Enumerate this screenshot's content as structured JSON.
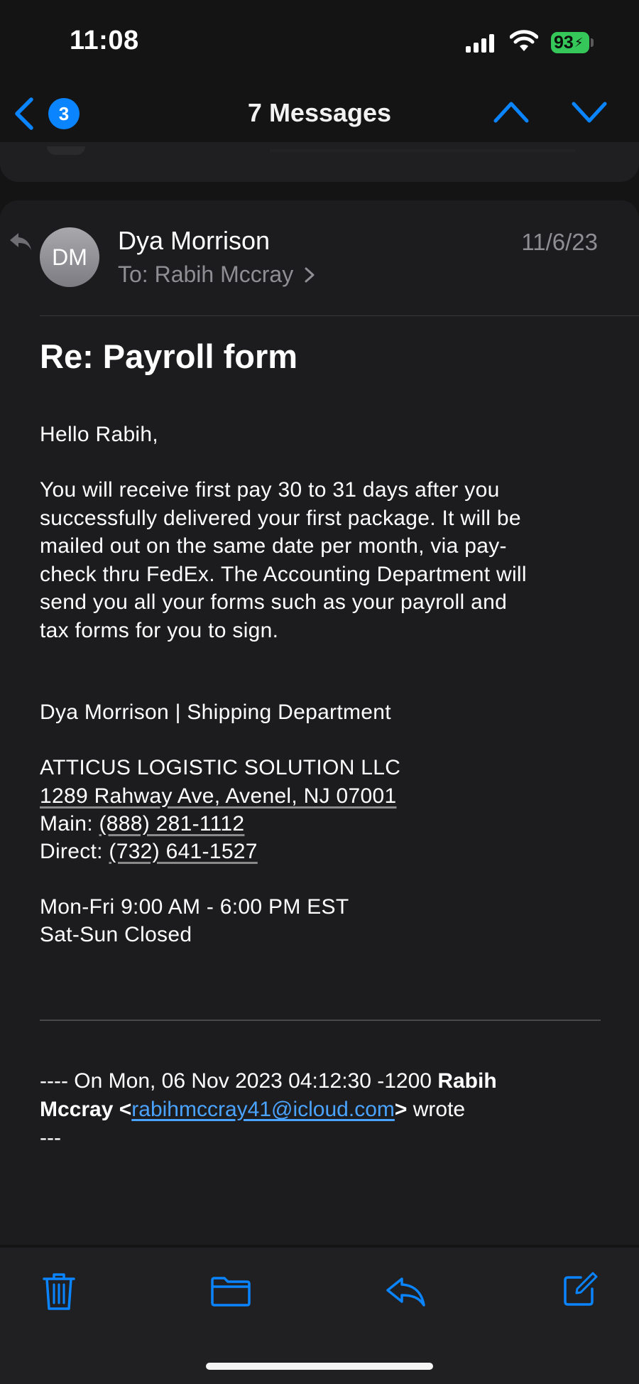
{
  "status_bar": {
    "time": "11:08",
    "battery": "93"
  },
  "nav": {
    "unread_count": "3",
    "title": "7 Messages"
  },
  "message": {
    "avatar_initials": "DM",
    "sender": "Dya Morrison",
    "to_label": "To:",
    "recipient": "Rabih Mccray",
    "date": "11/6/23",
    "subject": "Re: Payroll form",
    "greeting": "Hello Rabih,",
    "paragraph_lines": [
      "You will receive first pay 30 to 31 days after you",
      "successfully delivered your first package. It will be",
      "mailed out on the same date per month, via pay-",
      "check thru FedEx. The Accounting Department will",
      "send you all your forms such as your payroll and",
      "tax forms for you to sign."
    ],
    "signature": "Dya Morrison | Shipping Department",
    "company": "ATTICUS LOGISTIC SOLUTION LLC",
    "address": "1289 Rahway Ave, Avenel, NJ 07001",
    "main_label": "Main:",
    "main_phone": "(888) 281-1112",
    "direct_label": "Direct:",
    "direct_phone": "(732) 641-1527",
    "hours_weekday": "Mon-Fri 9:00 AM - 6:00 PM EST",
    "hours_weekend": "Sat-Sun Closed",
    "quote_prefix": "---- On Mon, 06 Nov 2023 04:12:30 -1200",
    "quote_name_1": "Rabih",
    "quote_name_2": "Mccray",
    "quote_lt": "<",
    "quote_email": "rabihmccray41@icloud.com",
    "quote_gt": ">",
    "quote_suffix": "wrote",
    "quote_dashes": "---"
  },
  "colors": {
    "accent": "#0a84ff",
    "link": "#4aa3ff",
    "battery": "#35c759"
  },
  "icons": [
    "back-chevron-icon",
    "chevron-up-icon",
    "chevron-down-icon",
    "reply-indicator-icon",
    "trash-icon",
    "folder-icon",
    "reply-icon",
    "compose-icon"
  ]
}
